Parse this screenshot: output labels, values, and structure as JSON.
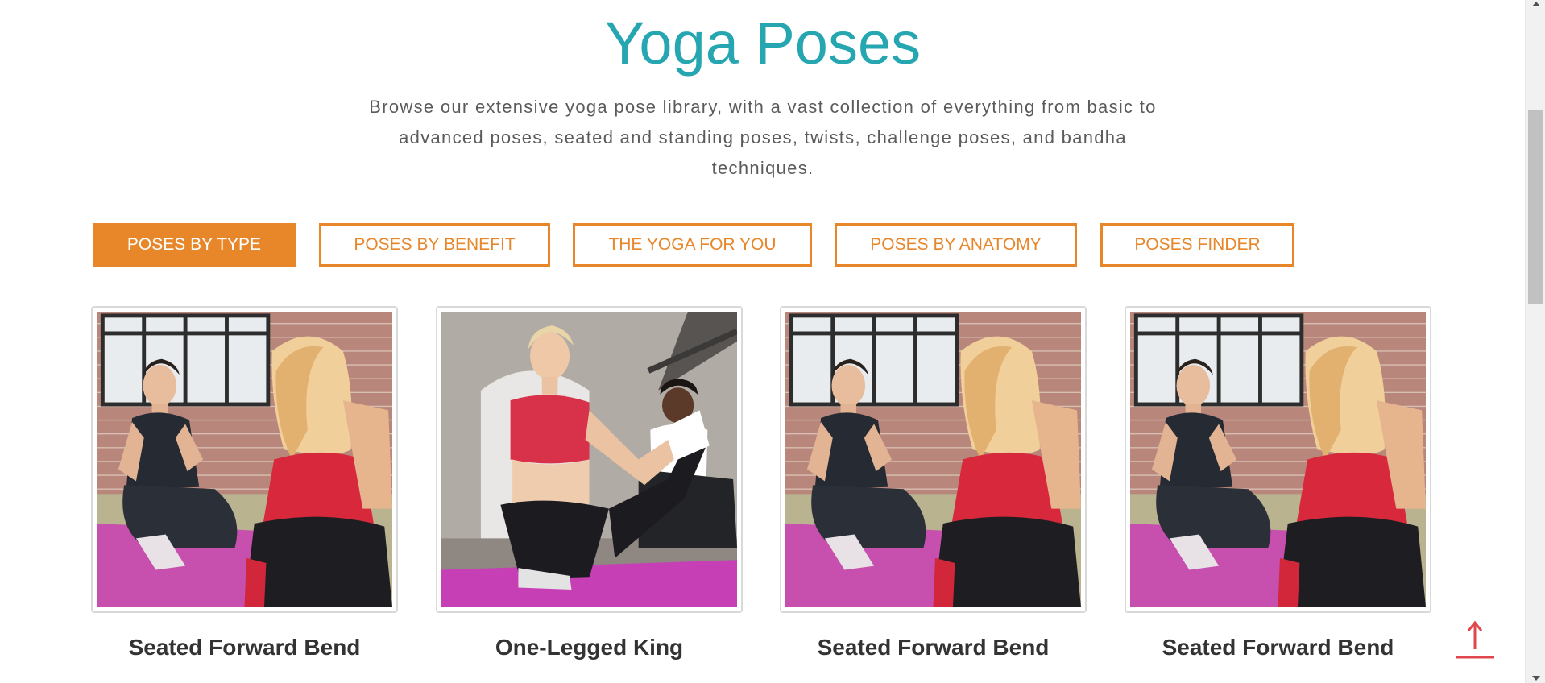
{
  "header": {
    "title": "Yoga Poses",
    "intro_line1": "Browse our extensive yoga pose library, with a vast collection of everything from basic to",
    "intro_line2": "advanced poses, seated and standing poses, twists, challenge poses, and bandha",
    "intro_line3": "techniques."
  },
  "tabs": [
    {
      "label": "POSES BY TYPE",
      "active": true
    },
    {
      "label": "POSES BY BENEFIT",
      "active": false
    },
    {
      "label": "THE YOGA FOR YOU",
      "active": false
    },
    {
      "label": "POSES BY ANATOMY",
      "active": false
    },
    {
      "label": "POSES FINDER",
      "active": false
    }
  ],
  "cards": [
    {
      "title": "Seated Forward Bend",
      "image": "two-women-seated-on-mat-photo"
    },
    {
      "title": "One-Legged King",
      "image": "woman-kneeling-stretch-photo"
    },
    {
      "title": "Seated Forward Bend",
      "image": "two-women-seated-on-mat-photo"
    },
    {
      "title": "Seated Forward Bend",
      "image": "two-women-seated-on-mat-photo"
    }
  ],
  "colors": {
    "title": "#26a6b0",
    "accent": "#e8862a",
    "back_to_top": "#e0474c"
  },
  "icons": {
    "back_to_top": "arrow-up-icon"
  }
}
